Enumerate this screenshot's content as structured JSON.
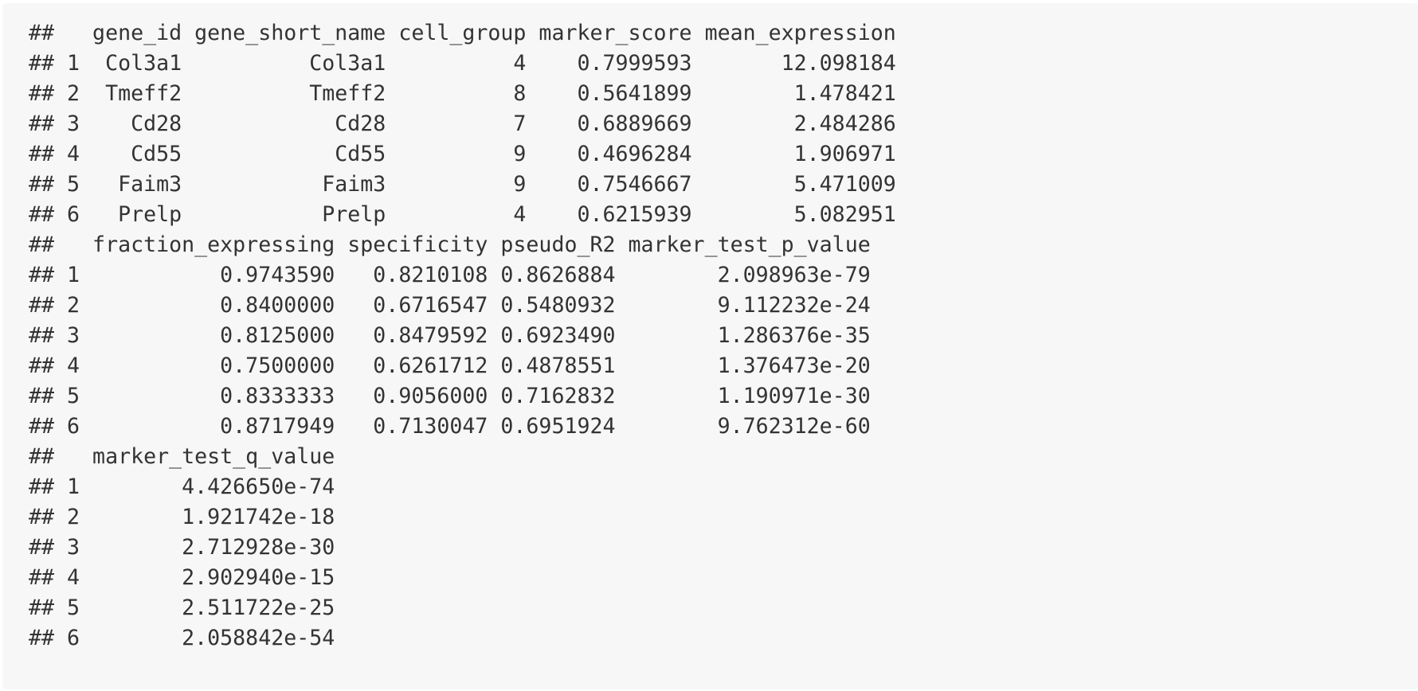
{
  "output": {
    "lines": [
      "##   gene_id gene_short_name cell_group marker_score mean_expression",
      "## 1  Col3a1          Col3a1          4    0.7999593       12.098184",
      "## 2  Tmeff2          Tmeff2          8    0.5641899        1.478421",
      "## 3    Cd28            Cd28          7    0.6889669        2.484286",
      "## 4    Cd55            Cd55          9    0.4696284        1.906971",
      "## 5   Faim3           Faim3          9    0.7546667        5.471009",
      "## 6   Prelp           Prelp          4    0.6215939        5.082951",
      "##   fraction_expressing specificity pseudo_R2 marker_test_p_value",
      "## 1           0.9743590   0.8210108 0.8626884        2.098963e-79",
      "## 2           0.8400000   0.6716547 0.5480932        9.112232e-24",
      "## 3           0.8125000   0.8479592 0.6923490        1.286376e-35",
      "## 4           0.7500000   0.6261712 0.4878551        1.376473e-20",
      "## 5           0.8333333   0.9056000 0.7162832        1.190971e-30",
      "## 6           0.8717949   0.7130047 0.6951924        9.762312e-60",
      "##   marker_test_q_value",
      "## 1        4.426650e-74",
      "## 2        1.921742e-18",
      "## 3        2.712928e-30",
      "## 4        2.902940e-15",
      "## 5        2.511722e-25",
      "## 6        2.058842e-54"
    ]
  },
  "colors": {
    "background": "#f7f7f7",
    "text": "#333333"
  }
}
